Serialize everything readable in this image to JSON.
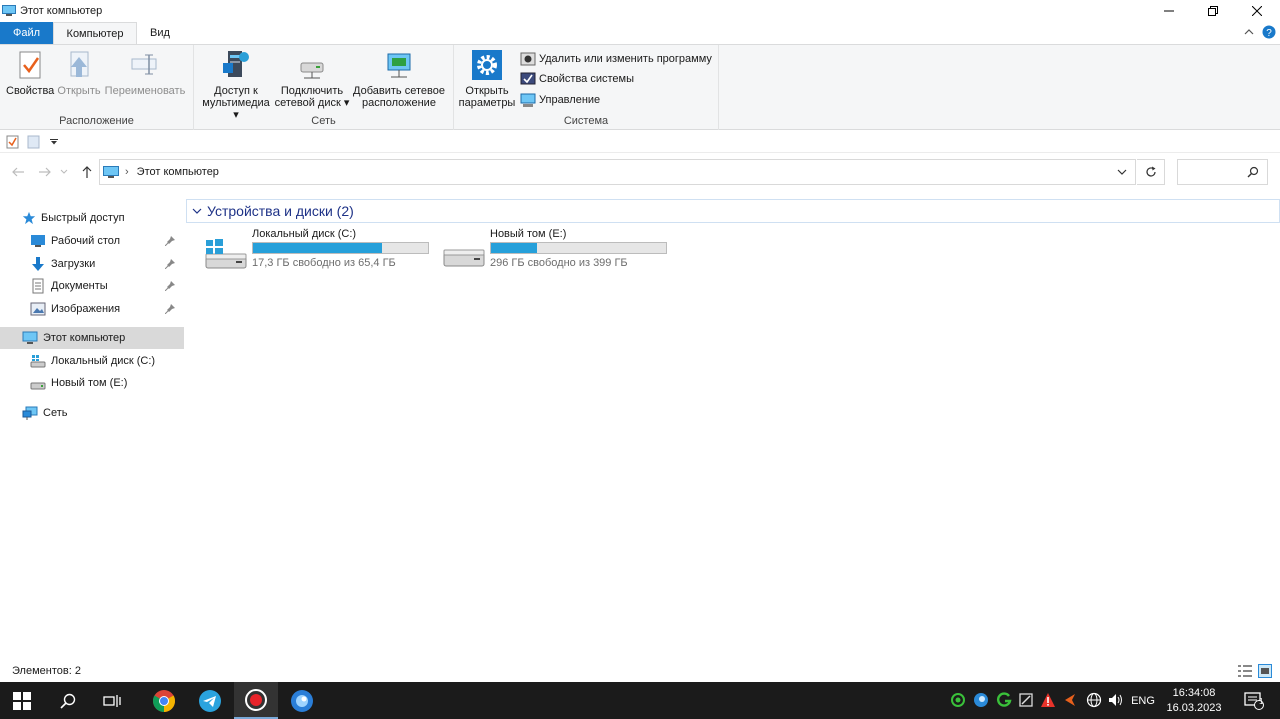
{
  "window": {
    "title": "Этот компьютер"
  },
  "tabs": {
    "file": "Файл",
    "computer": "Компьютер",
    "view": "Вид"
  },
  "ribbon": {
    "location": {
      "label": "Расположение",
      "properties": "Свойства",
      "open": "Открыть",
      "rename": "Переименовать"
    },
    "network": {
      "label": "Сеть",
      "media_line1": "Доступ к",
      "media_line2": "мультимедиа",
      "map_line1": "Подключить",
      "map_line2": "сетевой диск",
      "add_line1": "Добавить сетевое",
      "add_line2": "расположение"
    },
    "system": {
      "label": "Система",
      "open_line1": "Открыть",
      "open_line2": "параметры",
      "uninstall": "Удалить или изменить программу",
      "sysprops": "Свойства системы",
      "manage": "Управление"
    }
  },
  "address": {
    "path": "Этот компьютер",
    "separator": "›"
  },
  "nav": {
    "quick_access": "Быстрый доступ",
    "desktop": "Рабочий стол",
    "downloads": "Загрузки",
    "documents": "Документы",
    "pictures": "Изображения",
    "this_pc": "Этот компьютер",
    "drive_c": "Локальный диск (C:)",
    "drive_e": "Новый том (E:)",
    "network": "Сеть"
  },
  "content": {
    "group_title": "Устройства и диски (2)",
    "drives": [
      {
        "name": "Локальный диск (C:)",
        "free": "17,3 ГБ свободно из 65,4 ГБ",
        "used_fraction": 0.735
      },
      {
        "name": "Новый том (E:)",
        "free": "296 ГБ свободно из 399 ГБ",
        "used_fraction": 0.26
      }
    ]
  },
  "status": {
    "items": "Элементов: 2"
  },
  "taskbar": {
    "lang": "ENG",
    "time": "16:34:08",
    "date": "16.03.2023",
    "notif_count": "1"
  },
  "colors": {
    "accent": "#1979ca",
    "bar_fill": "#26a0da",
    "taskbar": "#1b1b1b",
    "group_title": "#1e3287"
  }
}
